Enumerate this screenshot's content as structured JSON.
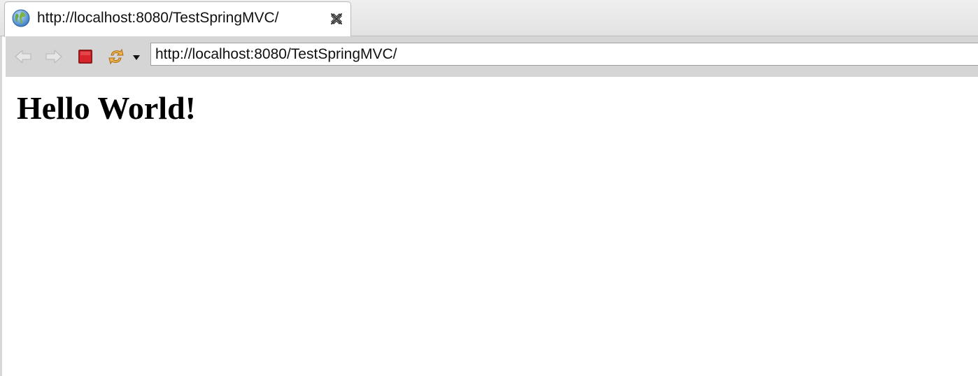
{
  "tab": {
    "title": "http://localhost:8080/TestSpringMVC/",
    "icon": "globe-icon",
    "close_icon": "close-icon"
  },
  "toolbar": {
    "back_icon": "back-arrow-icon",
    "forward_icon": "forward-arrow-icon",
    "stop_icon": "stop-icon",
    "refresh_icon": "refresh-icon",
    "dropdown_icon": "dropdown-arrow-icon",
    "url": "http://localhost:8080/TestSpringMVC/"
  },
  "page": {
    "heading": "Hello World!"
  },
  "colors": {
    "stop": "#d8242b",
    "refresh": "#e8a23a",
    "toolbar_bg": "#d5d5d5"
  }
}
